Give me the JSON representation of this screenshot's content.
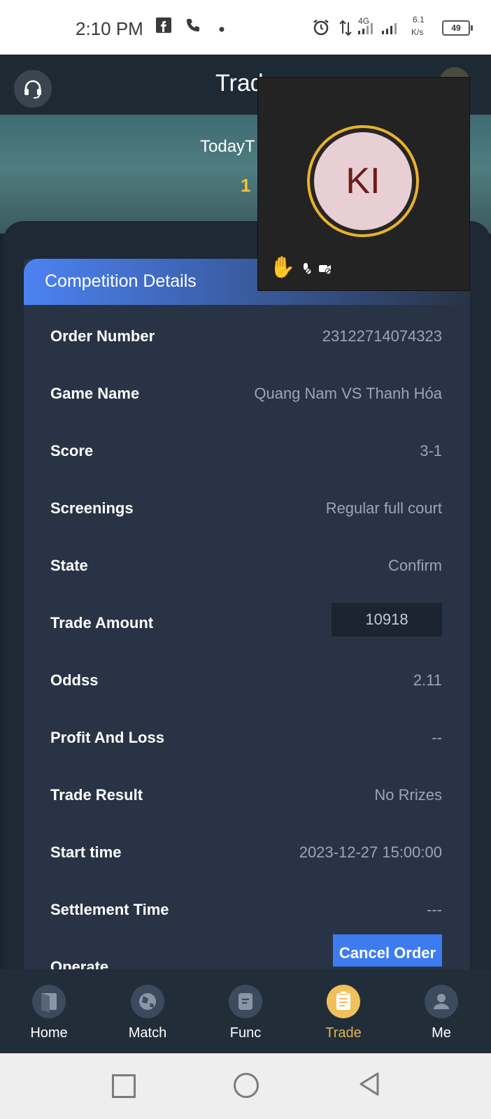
{
  "status_bar": {
    "time": "2:10 PM",
    "network": "4G",
    "speed_value": "6.1",
    "speed_unit": "K/s",
    "battery": "49",
    "icons": [
      "facebook-icon",
      "phone-icon",
      "alarm-icon",
      "data-arrows-icon",
      "signal-icon"
    ]
  },
  "header": {
    "title": "Trade",
    "support_icon": "headset-icon"
  },
  "banner": {
    "label": "TodayT",
    "value": "1"
  },
  "details": {
    "title": "Competition Details",
    "rows": [
      {
        "label": "Order Number",
        "value": "23122714074323"
      },
      {
        "label": "Game Name",
        "value": "Quang Nam VS Thanh Hóa"
      },
      {
        "label": "Score",
        "value": "3-1"
      },
      {
        "label": "Screenings",
        "value": "Regular full court"
      },
      {
        "label": "State",
        "value": "Confirm"
      },
      {
        "label": "Trade Amount",
        "value": "10918"
      },
      {
        "label": "Oddss",
        "value": "2.11"
      },
      {
        "label": "Profit And Loss",
        "value": "--"
      },
      {
        "label": "Trade Result",
        "value": "No Rrizes"
      },
      {
        "label": "Start time",
        "value": "2023-12-27 15:00:00"
      },
      {
        "label": "Settlement Time",
        "value": "---"
      },
      {
        "label": "Operate",
        "value": "Cancel Order"
      }
    ]
  },
  "video_overlay": {
    "initials": "KI",
    "icons": [
      "raised-hand-icon",
      "mic-off-icon",
      "camera-off-icon"
    ],
    "ring_color": "#e9b22a",
    "hand_color": "#f4b51d"
  },
  "tabs": [
    {
      "label": "Home",
      "icon": "home-door-icon",
      "active": false
    },
    {
      "label": "Match",
      "icon": "ball-icon",
      "active": false
    },
    {
      "label": "Func",
      "icon": "document-icon",
      "active": false
    },
    {
      "label": "Trade",
      "icon": "clipboard-icon",
      "active": true
    },
    {
      "label": "Me",
      "icon": "user-icon",
      "active": false
    }
  ],
  "colors": {
    "accent": "#3d7cf0",
    "active_tab": "#e5b24a",
    "banner_value": "#f2c230"
  }
}
